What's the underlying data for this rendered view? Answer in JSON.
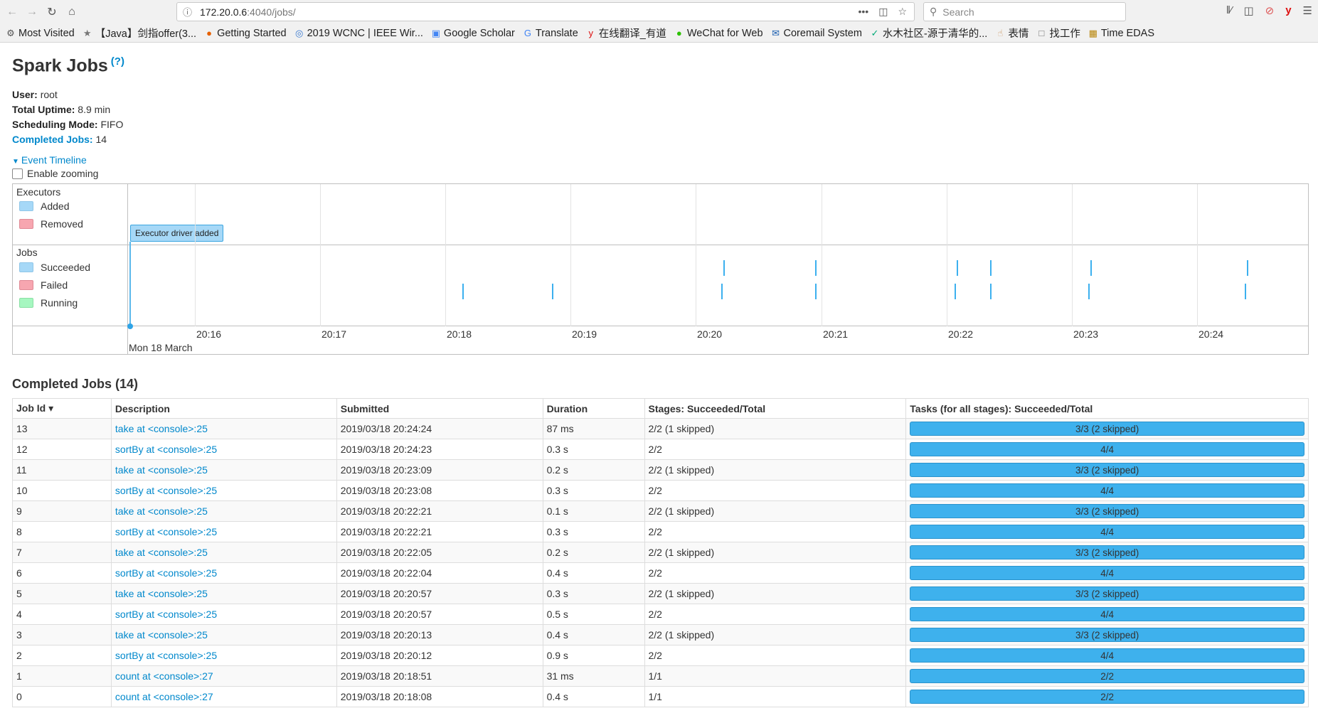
{
  "browser": {
    "url_host": "172.20.0.6",
    "url_path": ":4040/jobs/",
    "search_placeholder": "Search",
    "bookmarks": [
      {
        "label": "Most Visited",
        "icon": "gear-icon"
      },
      {
        "label": "【Java】剑指offer(3...",
        "icon": "bookmark-icon"
      },
      {
        "label": "Getting Started",
        "icon": "firefox-icon"
      },
      {
        "label": "2019 WCNC | IEEE Wir...",
        "icon": "globe-icon"
      },
      {
        "label": "Google Scholar",
        "icon": "scholar-icon"
      },
      {
        "label": "Translate",
        "icon": "translate-icon"
      },
      {
        "label": "在线翻译_有道",
        "icon": "youdao-icon"
      },
      {
        "label": "WeChat for Web",
        "icon": "wechat-icon"
      },
      {
        "label": "Coremail System",
        "icon": "mail-icon"
      },
      {
        "label": "水木社区-源于清华的...",
        "icon": "newsmth-icon"
      },
      {
        "label": "表情",
        "icon": "thumb-icon"
      },
      {
        "label": "找工作",
        "icon": "folder-icon"
      },
      {
        "label": "Time EDAS",
        "icon": "edas-icon"
      }
    ]
  },
  "page": {
    "title": "Spark Jobs",
    "help": "(?)",
    "user_label": "User:",
    "user": "root",
    "uptime_label": "Total Uptime:",
    "uptime": "8.9 min",
    "sched_label": "Scheduling Mode:",
    "sched": "FIFO",
    "completed_label": "Completed Jobs:",
    "completed": "14",
    "event_timeline": "Event Timeline",
    "enable_zooming": "Enable zooming"
  },
  "timeline": {
    "executors_label": "Executors",
    "jobs_label": "Jobs",
    "added": "Added",
    "removed": "Removed",
    "succeeded": "Succeeded",
    "failed": "Failed",
    "running": "Running",
    "executor_event": "Executor driver added",
    "date": "Mon 18 March",
    "ticks": [
      "20:16",
      "20:17",
      "20:18",
      "20:19",
      "20:20",
      "20:21",
      "20:22",
      "20:23",
      "20:24"
    ],
    "colors": {
      "added": "#a6d8f7",
      "removed": "#f7a6b0",
      "succeeded": "#a6d8f7",
      "failed": "#f7a6b0",
      "running": "#a6f7c0"
    }
  },
  "jobs": {
    "section_title": "Completed Jobs (14)",
    "headers": [
      "Job Id ▾",
      "Description",
      "Submitted",
      "Duration",
      "Stages: Succeeded/Total",
      "Tasks (for all stages): Succeeded/Total"
    ],
    "rows": [
      {
        "id": "13",
        "desc": "take at <console>:25",
        "submitted": "2019/03/18 20:24:24",
        "duration": "87 ms",
        "stages": "2/2 (1 skipped)",
        "tasks": "3/3 (2 skipped)"
      },
      {
        "id": "12",
        "desc": "sortBy at <console>:25",
        "submitted": "2019/03/18 20:24:23",
        "duration": "0.3 s",
        "stages": "2/2",
        "tasks": "4/4"
      },
      {
        "id": "11",
        "desc": "take at <console>:25",
        "submitted": "2019/03/18 20:23:09",
        "duration": "0.2 s",
        "stages": "2/2 (1 skipped)",
        "tasks": "3/3 (2 skipped)"
      },
      {
        "id": "10",
        "desc": "sortBy at <console>:25",
        "submitted": "2019/03/18 20:23:08",
        "duration": "0.3 s",
        "stages": "2/2",
        "tasks": "4/4"
      },
      {
        "id": "9",
        "desc": "take at <console>:25",
        "submitted": "2019/03/18 20:22:21",
        "duration": "0.1 s",
        "stages": "2/2 (1 skipped)",
        "tasks": "3/3 (2 skipped)"
      },
      {
        "id": "8",
        "desc": "sortBy at <console>:25",
        "submitted": "2019/03/18 20:22:21",
        "duration": "0.3 s",
        "stages": "2/2",
        "tasks": "4/4"
      },
      {
        "id": "7",
        "desc": "take at <console>:25",
        "submitted": "2019/03/18 20:22:05",
        "duration": "0.2 s",
        "stages": "2/2 (1 skipped)",
        "tasks": "3/3 (2 skipped)"
      },
      {
        "id": "6",
        "desc": "sortBy at <console>:25",
        "submitted": "2019/03/18 20:22:04",
        "duration": "0.4 s",
        "stages": "2/2",
        "tasks": "4/4"
      },
      {
        "id": "5",
        "desc": "take at <console>:25",
        "submitted": "2019/03/18 20:20:57",
        "duration": "0.3 s",
        "stages": "2/2 (1 skipped)",
        "tasks": "3/3 (2 skipped)"
      },
      {
        "id": "4",
        "desc": "sortBy at <console>:25",
        "submitted": "2019/03/18 20:20:57",
        "duration": "0.5 s",
        "stages": "2/2",
        "tasks": "4/4"
      },
      {
        "id": "3",
        "desc": "take at <console>:25",
        "submitted": "2019/03/18 20:20:13",
        "duration": "0.4 s",
        "stages": "2/2 (1 skipped)",
        "tasks": "3/3 (2 skipped)"
      },
      {
        "id": "2",
        "desc": "sortBy at <console>:25",
        "submitted": "2019/03/18 20:20:12",
        "duration": "0.9 s",
        "stages": "2/2",
        "tasks": "4/4"
      },
      {
        "id": "1",
        "desc": "count at <console>:27",
        "submitted": "2019/03/18 20:18:51",
        "duration": "31 ms",
        "stages": "1/1",
        "tasks": "2/2"
      },
      {
        "id": "0",
        "desc": "count at <console>:27",
        "submitted": "2019/03/18 20:18:08",
        "duration": "0.4 s",
        "stages": "1/1",
        "tasks": "2/2"
      }
    ]
  }
}
